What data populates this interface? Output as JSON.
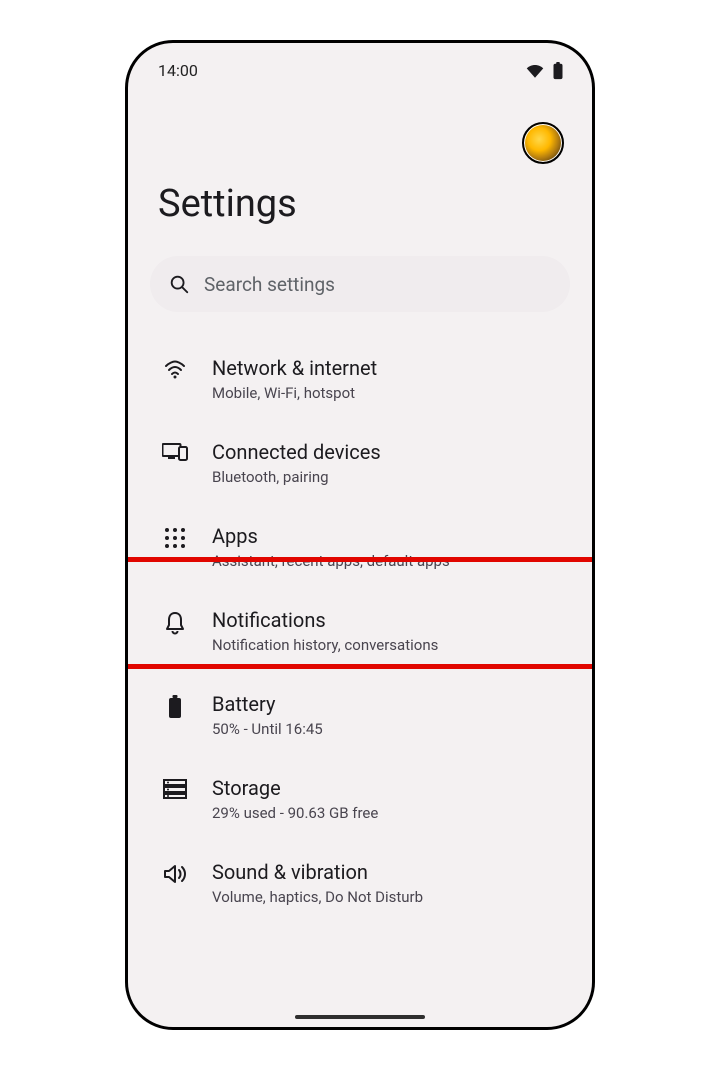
{
  "status": {
    "time": "14:00"
  },
  "title": "Settings",
  "search": {
    "placeholder": "Search settings"
  },
  "items": [
    {
      "title": "Network & internet",
      "sub": "Mobile, Wi-Fi, hotspot"
    },
    {
      "title": "Connected devices",
      "sub": "Bluetooth, pairing"
    },
    {
      "title": "Apps",
      "sub": "Assistant, recent apps, default apps"
    },
    {
      "title": "Notifications",
      "sub": "Notification history, conversations"
    },
    {
      "title": "Battery",
      "sub": "50% - Until 16:45"
    },
    {
      "title": "Storage",
      "sub": "29% used - 90.63 GB free"
    },
    {
      "title": "Sound & vibration",
      "sub": "Volume, haptics, Do Not Disturb"
    }
  ]
}
